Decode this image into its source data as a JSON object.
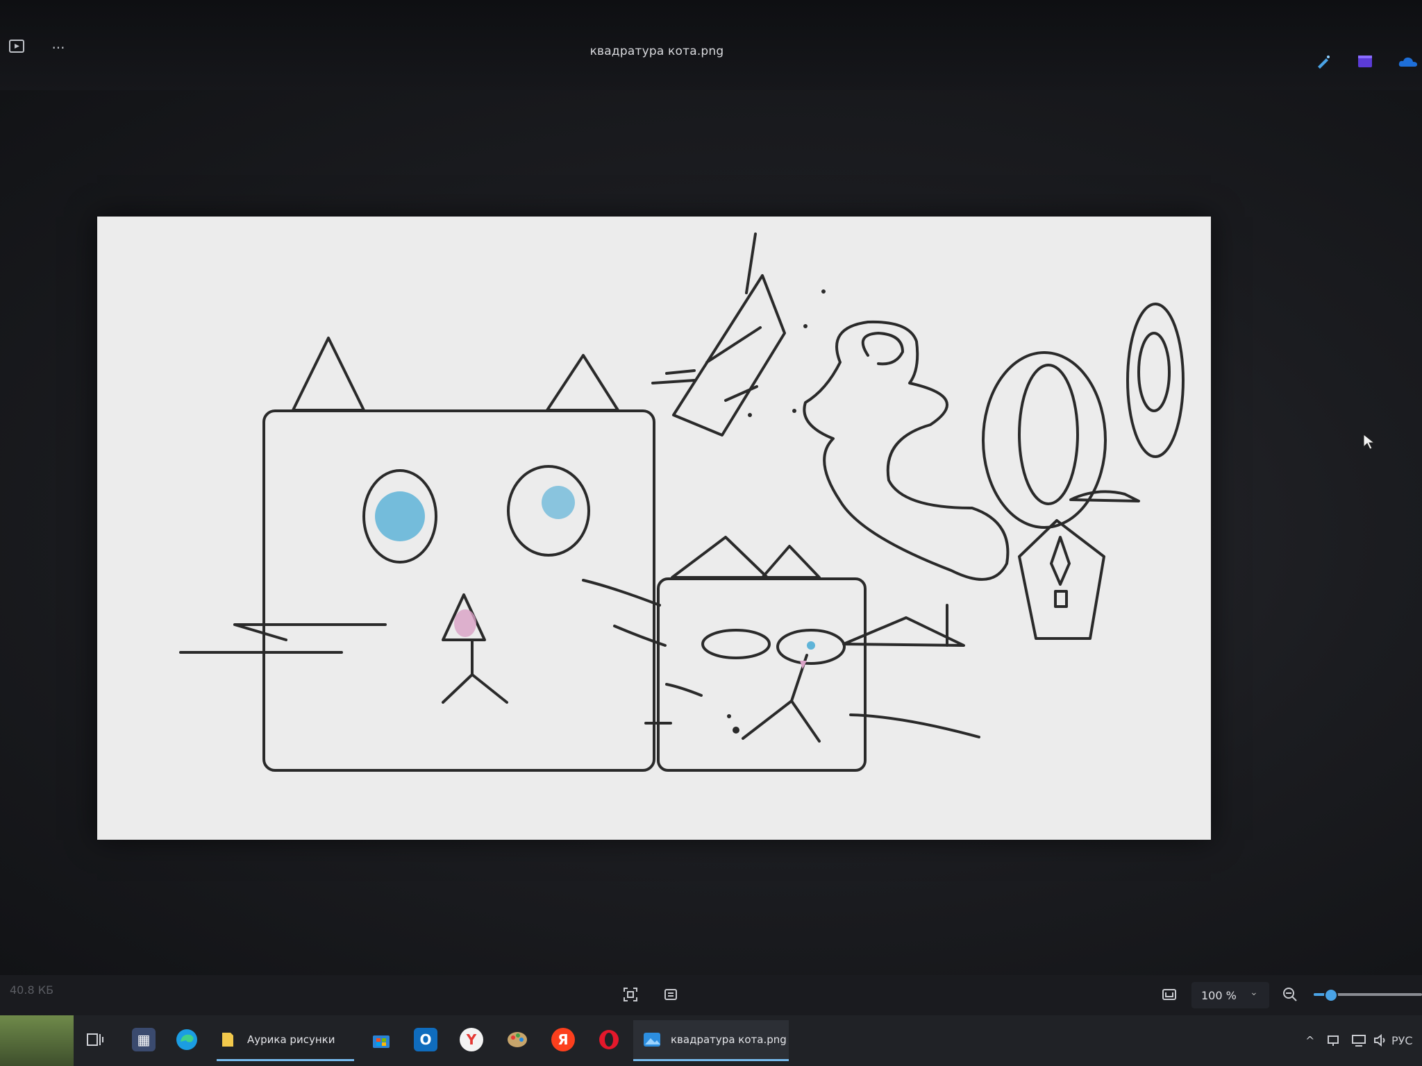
{
  "window": {
    "title": "квадратура кота.png",
    "more_label": "···"
  },
  "status": {
    "file_size": "40.8 КБ",
    "zoom_value": "100 %",
    "zoom_fraction": 0.15
  },
  "taskbar": {
    "folder_label": "Аурика рисунки",
    "photos_label": "квадратура кота.png",
    "yandex_letter": "Я"
  },
  "tray": {
    "language": "РУС"
  },
  "colors": {
    "background": "#141518",
    "accent": "#4aa3e6",
    "drawing_stroke": "#2a2a2a",
    "eye_fill": "#5fb4d8",
    "nose_pink": "#d9a1c6"
  },
  "icons": [
    "slideshow-icon",
    "more-icon",
    "edit-icon",
    "video-editor-icon",
    "onedrive-icon",
    "fit-to-window-icon",
    "crop-icon",
    "actual-size-icon",
    "zoom-out-icon",
    "task-view-icon",
    "edge-icon",
    "folder-icon",
    "store-icon",
    "outlook-icon",
    "yandex-browser-icon",
    "paint-icon",
    "yandex-icon",
    "opera-icon",
    "photos-icon",
    "chevron-up-icon",
    "network-icon",
    "volume-icon"
  ]
}
